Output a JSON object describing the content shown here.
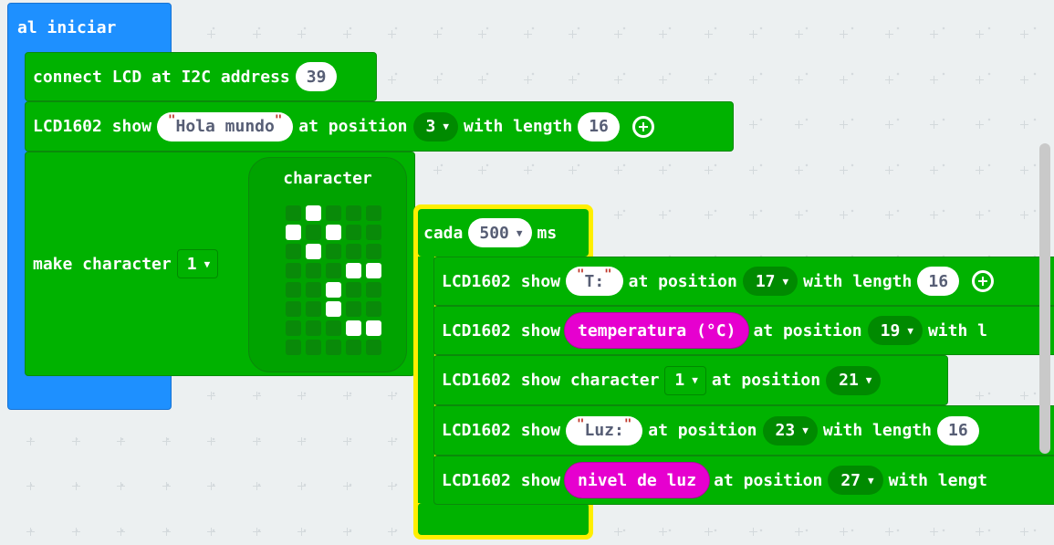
{
  "on_start": {
    "label": "al iniciar",
    "connect": {
      "label": "connect LCD at I2C address",
      "address": "39"
    },
    "show_hello": {
      "prefix": "LCD1602 show",
      "text": "Hola mundo",
      "at_position": "at position",
      "position": "3",
      "with_length": "with length",
      "length": "16"
    },
    "make_char": {
      "label": "make character",
      "index": "1",
      "title": "character",
      "pattern": [
        [
          0,
          1,
          0,
          0,
          0
        ],
        [
          1,
          0,
          1,
          0,
          0
        ],
        [
          0,
          1,
          0,
          0,
          0
        ],
        [
          0,
          0,
          0,
          1,
          1
        ],
        [
          0,
          0,
          1,
          0,
          0
        ],
        [
          0,
          0,
          1,
          0,
          0
        ],
        [
          0,
          0,
          0,
          1,
          1
        ],
        [
          0,
          0,
          0,
          0,
          0
        ]
      ]
    }
  },
  "every": {
    "label": "cada",
    "interval": "500",
    "unit": "ms",
    "rows": [
      {
        "prefix": "LCD1602 show",
        "text": "T:",
        "at_position": "at position",
        "position": "17",
        "with_length": "with length",
        "length": "16"
      },
      {
        "prefix": "LCD1602 show",
        "variable": "temperatura (°C)",
        "at_position": "at position",
        "position": "19",
        "with_length": "with l"
      },
      {
        "prefix": "LCD1602 show character",
        "index": "1",
        "at_position": "at position",
        "position": "21"
      },
      {
        "prefix": "LCD1602 show",
        "text": "Luz:",
        "at_position": "at position",
        "position": "23",
        "with_length": "with length",
        "length": "16"
      },
      {
        "prefix": "LCD1602 show",
        "variable": "nivel de luz",
        "at_position": "at position",
        "position": "27",
        "with_length": "with lengt"
      }
    ]
  },
  "colors": {
    "event_blue": "#1e90ff",
    "block_green": "#00b200",
    "highlight_yellow": "#ffef00",
    "variable_magenta": "#e600cf"
  }
}
